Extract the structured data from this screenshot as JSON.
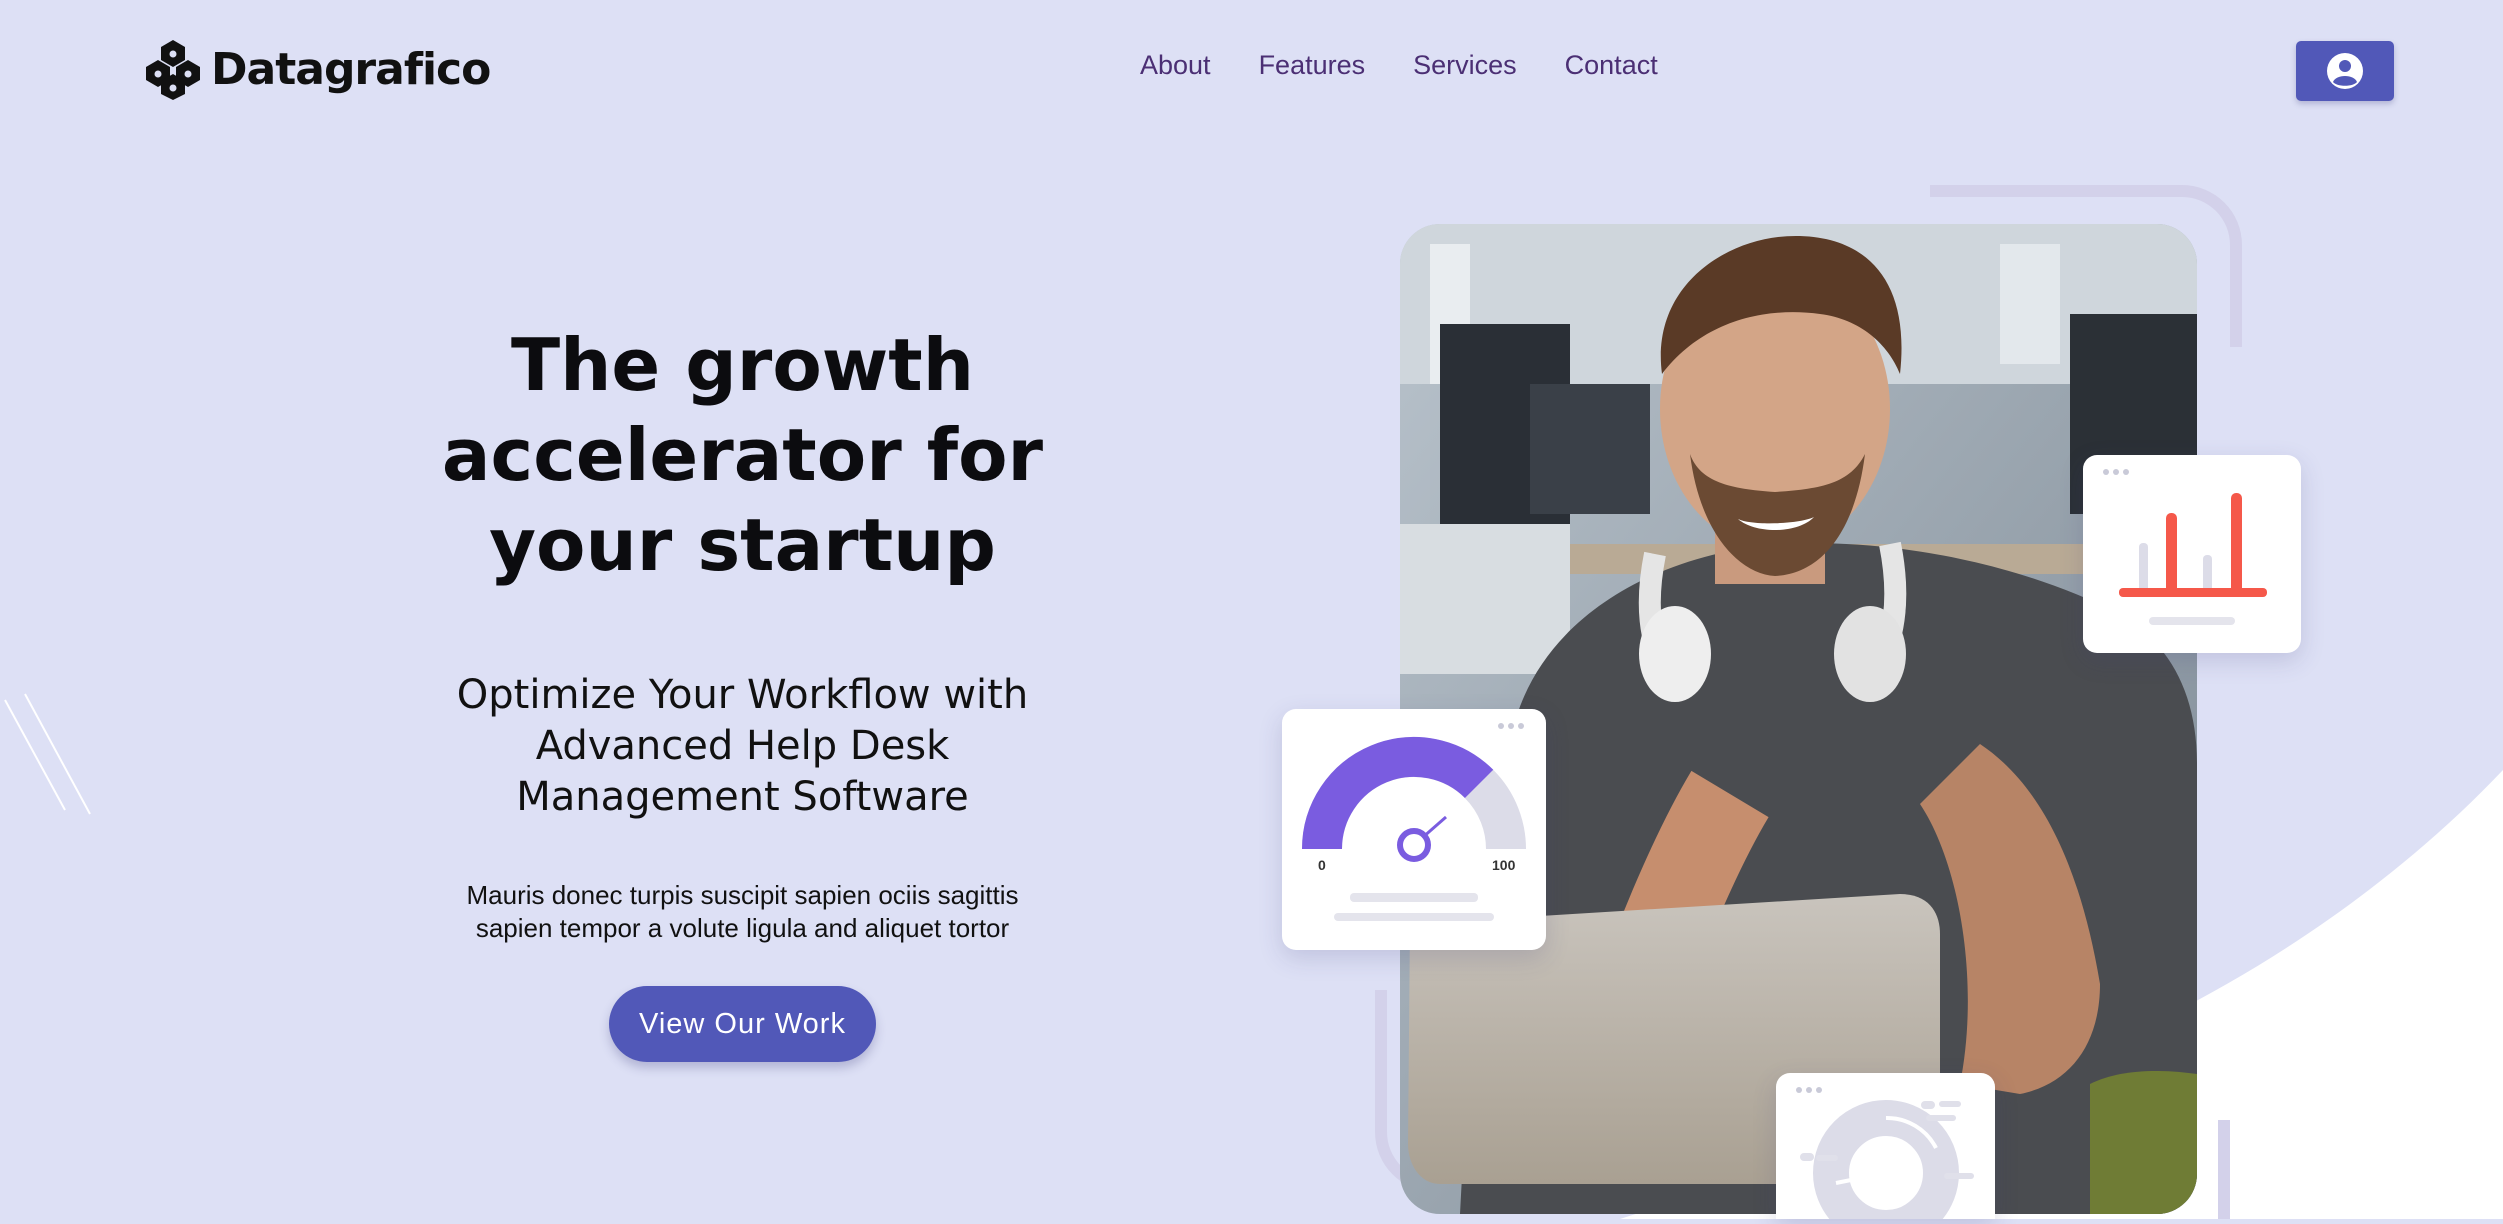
{
  "brand": {
    "name": "Datagrafico",
    "logo_icon": "hexagon-cluster-logo"
  },
  "nav": {
    "items": [
      {
        "label": "About"
      },
      {
        "label": "Features"
      },
      {
        "label": "Services"
      },
      {
        "label": "Contact"
      }
    ]
  },
  "header": {
    "account_icon": "user-circle-icon"
  },
  "hero": {
    "headline": [
      "The growth",
      "accelerator for",
      "your startup"
    ],
    "subheading": [
      "Optimize Your Workflow with",
      "Advanced Help Desk",
      "Management Software"
    ],
    "body": [
      "Mauris donec turpis suscipit sapien ociis sagittis",
      "sapien tempor a volute ligula and aliquet tortor"
    ],
    "cta_label": "View Our Work"
  },
  "cards": {
    "gauge": {
      "min_label": "0",
      "max_label": "100",
      "value_fraction": 0.75
    },
    "bar_chart_icon": "bar-chart-icon",
    "donut_chart_icon": "donut-chart-icon"
  },
  "colors": {
    "accent": "#5158b8",
    "background": "#dde0f5",
    "nav_text": "#4b2f74",
    "gauge": "#7a5ce0",
    "bars": "#f5584a"
  }
}
